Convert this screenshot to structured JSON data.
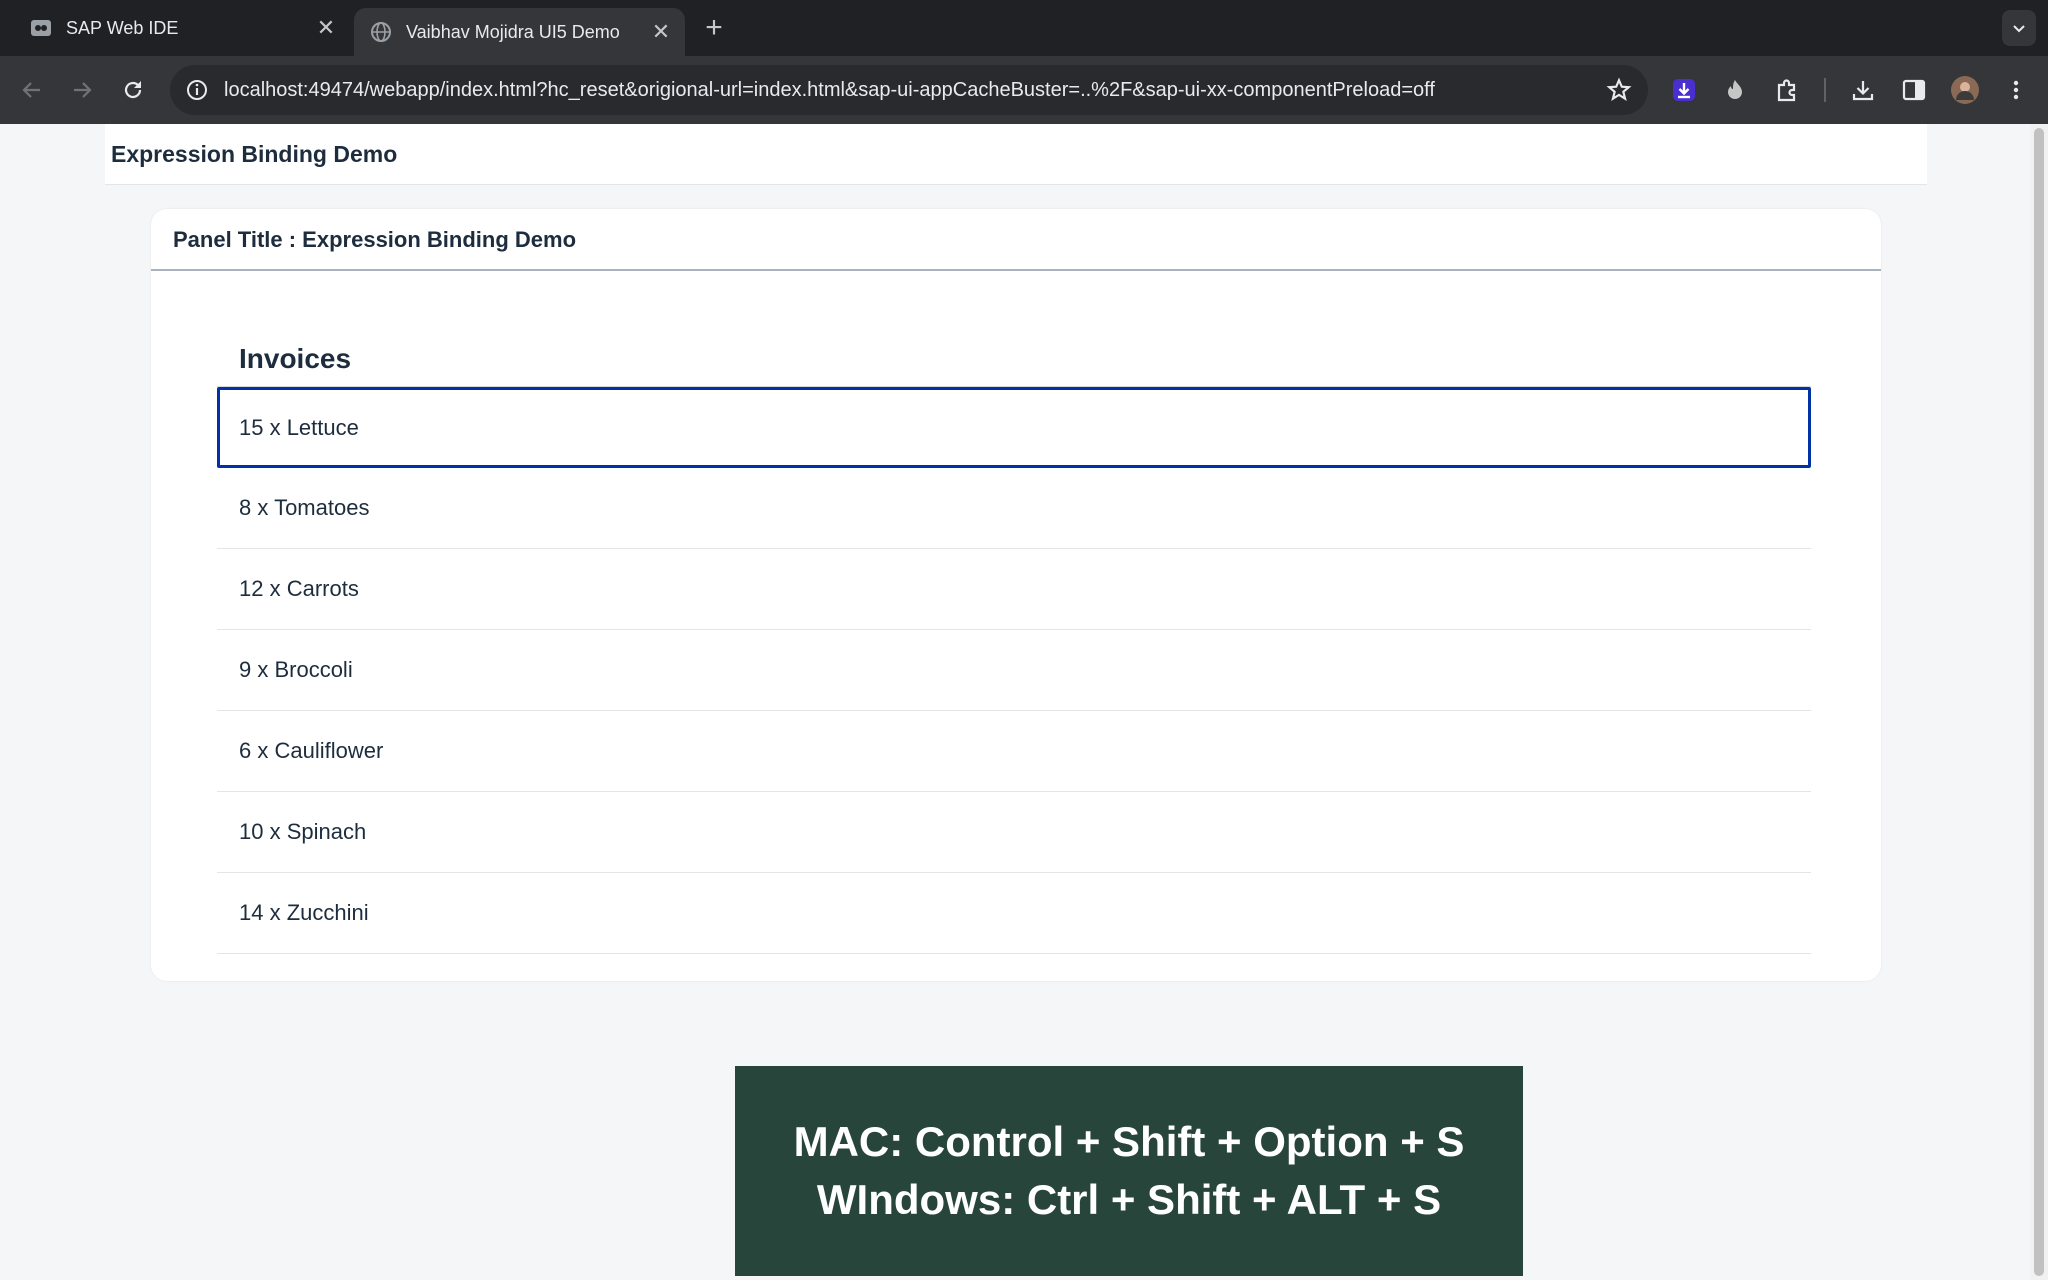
{
  "browser": {
    "tabs": [
      {
        "title": "SAP Web IDE",
        "icon": "sap-web-ide-icon",
        "active": false
      },
      {
        "title": "Vaibhav Mojidra UI5 Demo",
        "icon": "globe-icon",
        "active": true
      }
    ],
    "url": "localhost:49474/webapp/index.html?hc_reset&origional-url=index.html&sap-ui-appCacheBuster=..%2F&sap-ui-xx-componentPreload=off"
  },
  "app": {
    "title": "Expression Binding Demo",
    "panel_title": "Panel Title : Expression Binding Demo",
    "list_header": "Invoices",
    "items": [
      "15 x Lettuce",
      "8 x Tomatoes",
      "12 x Carrots",
      "9 x Broccoli",
      "6 x Cauliflower",
      "10 x Spinach",
      "14 x Zucchini"
    ]
  },
  "overlay": {
    "line1": "MAC: Control + Shift + Option + S",
    "line2": "WIndows: Ctrl + Shift + ALT + S"
  },
  "colors": {
    "focus_border": "#0032a5",
    "overlay_bg": "#27453b",
    "text": "#1d2d3e"
  }
}
